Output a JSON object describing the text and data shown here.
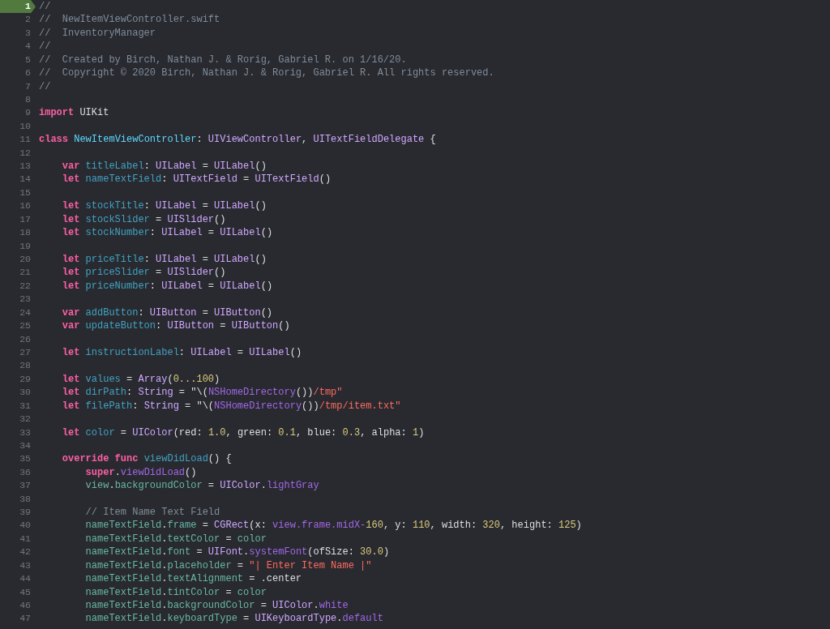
{
  "editor": {
    "lines": [
      {
        "number": "1",
        "selected": true,
        "tokens": [
          {
            "kind": "comment",
            "text": "//"
          }
        ]
      },
      {
        "number": "2",
        "selected": false,
        "tokens": [
          {
            "kind": "comment",
            "text": "//  NewItemViewController.swift"
          }
        ]
      },
      {
        "number": "3",
        "selected": false,
        "tokens": [
          {
            "kind": "comment",
            "text": "//  InventoryManager"
          }
        ]
      },
      {
        "number": "4",
        "selected": false,
        "tokens": [
          {
            "kind": "comment",
            "text": "//"
          }
        ]
      },
      {
        "number": "5",
        "selected": false,
        "tokens": [
          {
            "kind": "comment",
            "text": "//  Created by Birch, Nathan J. & Rorig, Gabriel R. on 1/16/20."
          }
        ]
      },
      {
        "number": "6",
        "selected": false,
        "tokens": [
          {
            "kind": "comment",
            "text": "//  Copyright © 2020 Birch, Nathan J. & Rorig, Gabriel R. All rights reserved."
          }
        ]
      },
      {
        "number": "7",
        "selected": false,
        "tokens": [
          {
            "kind": "comment",
            "text": "//"
          }
        ]
      },
      {
        "number": "8",
        "selected": false
      },
      {
        "number": "9",
        "selected": false,
        "tokens": [
          {
            "kind": "keyword",
            "text": "import"
          },
          {
            "kind": "plain",
            "text": " UIKit"
          }
        ]
      },
      {
        "number": "10",
        "selected": false
      },
      {
        "number": "11",
        "selected": false,
        "tokens": [
          {
            "kind": "keyword",
            "text": "class "
          },
          {
            "kind": "typedecl",
            "text": "NewItemViewController"
          },
          {
            "kind": "plain",
            "text": ": "
          },
          {
            "kind": "type",
            "text": "UIViewController"
          },
          {
            "kind": "plain",
            "text": ", "
          },
          {
            "kind": "type",
            "text": "UITextFieldDelegate"
          },
          {
            "kind": "plain",
            "text": " {"
          }
        ]
      },
      {
        "number": "12",
        "selected": false
      },
      {
        "number": "13",
        "selected": false,
        "tokens": [
          {
            "kind": "keyword",
            "text": "    var "
          },
          {
            "kind": "decl",
            "text": "titleLabel"
          },
          {
            "kind": "plain",
            "text": ": "
          },
          {
            "kind": "type",
            "text": "UILabel"
          },
          {
            "kind": "plain",
            "text": " = "
          },
          {
            "kind": "type",
            "text": "UILabel"
          },
          {
            "kind": "plain",
            "text": "()"
          }
        ]
      },
      {
        "number": "14",
        "selected": false,
        "tokens": [
          {
            "kind": "keyword",
            "text": "    let "
          },
          {
            "kind": "decl",
            "text": "nameTextField"
          },
          {
            "kind": "plain",
            "text": ": "
          },
          {
            "kind": "type",
            "text": "UITextField"
          },
          {
            "kind": "plain",
            "text": " = "
          },
          {
            "kind": "type",
            "text": "UITextField"
          },
          {
            "kind": "plain",
            "text": "()"
          }
        ]
      },
      {
        "number": "15",
        "selected": false
      },
      {
        "number": "16",
        "selected": false,
        "tokens": [
          {
            "kind": "keyword",
            "text": "    let "
          },
          {
            "kind": "decl",
            "text": "stockTitle"
          },
          {
            "kind": "plain",
            "text": ": "
          },
          {
            "kind": "type",
            "text": "UILabel"
          },
          {
            "kind": "plain",
            "text": " = "
          },
          {
            "kind": "type",
            "text": "UILabel"
          },
          {
            "kind": "plain",
            "text": "()"
          }
        ]
      },
      {
        "number": "17",
        "selected": false,
        "tokens": [
          {
            "kind": "keyword",
            "text": "    let "
          },
          {
            "kind": "decl",
            "text": "stockSlider"
          },
          {
            "kind": "plain",
            "text": " = "
          },
          {
            "kind": "type",
            "text": "UISlider"
          },
          {
            "kind": "plain",
            "text": "()"
          }
        ]
      },
      {
        "number": "18",
        "selected": false,
        "tokens": [
          {
            "kind": "keyword",
            "text": "    let "
          },
          {
            "kind": "decl",
            "text": "stockNumber"
          },
          {
            "kind": "plain",
            "text": ": "
          },
          {
            "kind": "type",
            "text": "UILabel"
          },
          {
            "kind": "plain",
            "text": " = "
          },
          {
            "kind": "type",
            "text": "UILabel"
          },
          {
            "kind": "plain",
            "text": "()"
          }
        ]
      },
      {
        "number": "19",
        "selected": false
      },
      {
        "number": "20",
        "selected": false,
        "tokens": [
          {
            "kind": "keyword",
            "text": "    let "
          },
          {
            "kind": "decl",
            "text": "priceTitle"
          },
          {
            "kind": "plain",
            "text": ": "
          },
          {
            "kind": "type",
            "text": "UILabel"
          },
          {
            "kind": "plain",
            "text": " = "
          },
          {
            "kind": "type",
            "text": "UILabel"
          },
          {
            "kind": "plain",
            "text": "()"
          }
        ]
      },
      {
        "number": "21",
        "selected": false,
        "tokens": [
          {
            "kind": "keyword",
            "text": "    let "
          },
          {
            "kind": "decl",
            "text": "priceSlider"
          },
          {
            "kind": "plain",
            "text": " = "
          },
          {
            "kind": "type",
            "text": "UISlider"
          },
          {
            "kind": "plain",
            "text": "()"
          }
        ]
      },
      {
        "number": "22",
        "selected": false,
        "tokens": [
          {
            "kind": "keyword",
            "text": "    let "
          },
          {
            "kind": "decl",
            "text": "priceNumber"
          },
          {
            "kind": "plain",
            "text": ": "
          },
          {
            "kind": "type",
            "text": "UILabel"
          },
          {
            "kind": "plain",
            "text": " = "
          },
          {
            "kind": "type",
            "text": "UILabel"
          },
          {
            "kind": "plain",
            "text": "()"
          }
        ]
      },
      {
        "number": "23",
        "selected": false
      },
      {
        "number": "24",
        "selected": false,
        "tokens": [
          {
            "kind": "keyword",
            "text": "    var "
          },
          {
            "kind": "decl",
            "text": "addButton"
          },
          {
            "kind": "plain",
            "text": ": "
          },
          {
            "kind": "type",
            "text": "UIButton"
          },
          {
            "kind": "plain",
            "text": " = "
          },
          {
            "kind": "type",
            "text": "UIButton"
          },
          {
            "kind": "plain",
            "text": "()"
          }
        ]
      },
      {
        "number": "25",
        "selected": false,
        "tokens": [
          {
            "kind": "keyword",
            "text": "    var "
          },
          {
            "kind": "decl",
            "text": "updateButton"
          },
          {
            "kind": "plain",
            "text": ": "
          },
          {
            "kind": "type",
            "text": "UIButton"
          },
          {
            "kind": "plain",
            "text": " = "
          },
          {
            "kind": "type",
            "text": "UIButton"
          },
          {
            "kind": "plain",
            "text": "()"
          }
        ]
      },
      {
        "number": "26",
        "selected": false
      },
      {
        "number": "27",
        "selected": false,
        "tokens": [
          {
            "kind": "keyword",
            "text": "    let "
          },
          {
            "kind": "decl",
            "text": "instructionLabel"
          },
          {
            "kind": "plain",
            "text": ": "
          },
          {
            "kind": "type",
            "text": "UILabel"
          },
          {
            "kind": "plain",
            "text": " = "
          },
          {
            "kind": "type",
            "text": "UILabel"
          },
          {
            "kind": "plain",
            "text": "()"
          }
        ]
      },
      {
        "number": "28",
        "selected": false
      },
      {
        "number": "29",
        "selected": false,
        "tokens": [
          {
            "kind": "keyword",
            "text": "    let "
          },
          {
            "kind": "decl",
            "text": "values"
          },
          {
            "kind": "plain",
            "text": " = "
          },
          {
            "kind": "type",
            "text": "Array"
          },
          {
            "kind": "plain",
            "text": "("
          },
          {
            "kind": "number",
            "text": "0...100"
          },
          {
            "kind": "plain",
            "text": ")"
          }
        ]
      },
      {
        "number": "30",
        "selected": false,
        "tokens": [
          {
            "kind": "keyword",
            "text": "    let "
          },
          {
            "kind": "decl",
            "text": "dirPath"
          },
          {
            "kind": "plain",
            "text": ": "
          },
          {
            "kind": "type",
            "text": "String"
          },
          {
            "kind": "plain",
            "text": " = \"\\("
          },
          {
            "kind": "member",
            "text": "NSHomeDirectory"
          },
          {
            "kind": "plain",
            "text": "())"
          },
          {
            "kind": "string",
            "text": "/tmp\""
          }
        ]
      },
      {
        "number": "31",
        "selected": false,
        "tokens": [
          {
            "kind": "keyword",
            "text": "    let "
          },
          {
            "kind": "decl",
            "text": "filePath"
          },
          {
            "kind": "plain",
            "text": ": "
          },
          {
            "kind": "type",
            "text": "String"
          },
          {
            "kind": "plain",
            "text": " = \"\\("
          },
          {
            "kind": "member",
            "text": "NSHomeDirectory"
          },
          {
            "kind": "plain",
            "text": "())"
          },
          {
            "kind": "string",
            "text": "/tmp/item.txt\""
          }
        ]
      },
      {
        "number": "32",
        "selected": false
      },
      {
        "number": "33",
        "selected": false,
        "tokens": [
          {
            "kind": "keyword",
            "text": "    let "
          },
          {
            "kind": "decl",
            "text": "color"
          },
          {
            "kind": "plain",
            "text": " = "
          },
          {
            "kind": "type",
            "text": "UIColor"
          },
          {
            "kind": "plain",
            "text": "(red: "
          },
          {
            "kind": "number",
            "text": "1.0"
          },
          {
            "kind": "plain",
            "text": ", green: "
          },
          {
            "kind": "number",
            "text": "0.1"
          },
          {
            "kind": "plain",
            "text": ", blue: "
          },
          {
            "kind": "number",
            "text": "0.3"
          },
          {
            "kind": "plain",
            "text": ", alpha: "
          },
          {
            "kind": "number",
            "text": "1"
          },
          {
            "kind": "plain",
            "text": ")"
          }
        ]
      },
      {
        "number": "34",
        "selected": false
      },
      {
        "number": "35",
        "selected": false,
        "tokens": [
          {
            "kind": "keyword",
            "text": "    override func "
          },
          {
            "kind": "decl",
            "text": "viewDidLoad"
          },
          {
            "kind": "plain",
            "text": "() {"
          }
        ]
      },
      {
        "number": "36",
        "selected": false,
        "tokens": [
          {
            "kind": "keyword",
            "text": "        super"
          },
          {
            "kind": "plain",
            "text": "."
          },
          {
            "kind": "member",
            "text": "viewDidLoad"
          },
          {
            "kind": "plain",
            "text": "()"
          }
        ]
      },
      {
        "number": "37",
        "selected": false,
        "tokens": [
          {
            "kind": "project",
            "text": "        view"
          },
          {
            "kind": "plain",
            "text": "."
          },
          {
            "kind": "project",
            "text": "backgroundColor"
          },
          {
            "kind": "plain",
            "text": " = "
          },
          {
            "kind": "type",
            "text": "UIColor"
          },
          {
            "kind": "plain",
            "text": "."
          },
          {
            "kind": "member",
            "text": "lightGray"
          }
        ]
      },
      {
        "number": "38",
        "selected": false
      },
      {
        "number": "39",
        "selected": false,
        "tokens": [
          {
            "kind": "comment",
            "text": "        // Item Name Text Field"
          }
        ]
      },
      {
        "number": "40",
        "selected": false,
        "tokens": [
          {
            "kind": "project",
            "text": "        nameTextField"
          },
          {
            "kind": "plain",
            "text": "."
          },
          {
            "kind": "project",
            "text": "frame"
          },
          {
            "kind": "plain",
            "text": " = "
          },
          {
            "kind": "type",
            "text": "CGRect"
          },
          {
            "kind": "plain",
            "text": "(x: "
          },
          {
            "kind": "member",
            "text": "view.frame.midX-"
          },
          {
            "kind": "number",
            "text": "160"
          },
          {
            "kind": "plain",
            "text": ", y: "
          },
          {
            "kind": "number",
            "text": "110"
          },
          {
            "kind": "plain",
            "text": ", width: "
          },
          {
            "kind": "number",
            "text": "320"
          },
          {
            "kind": "plain",
            "text": ", height: "
          },
          {
            "kind": "number",
            "text": "125"
          },
          {
            "kind": "plain",
            "text": ")"
          }
        ]
      },
      {
        "number": "41",
        "selected": false,
        "tokens": [
          {
            "kind": "project",
            "text": "        nameTextField"
          },
          {
            "kind": "plain",
            "text": "."
          },
          {
            "kind": "project",
            "text": "textColor"
          },
          {
            "kind": "plain",
            "text": " = "
          },
          {
            "kind": "project",
            "text": "color"
          }
        ]
      },
      {
        "number": "42",
        "selected": false,
        "tokens": [
          {
            "kind": "project",
            "text": "        nameTextField"
          },
          {
            "kind": "plain",
            "text": "."
          },
          {
            "kind": "project",
            "text": "font"
          },
          {
            "kind": "plain",
            "text": " = "
          },
          {
            "kind": "type",
            "text": "UIFont"
          },
          {
            "kind": "plain",
            "text": "."
          },
          {
            "kind": "member",
            "text": "systemFont"
          },
          {
            "kind": "plain",
            "text": "(ofSize: "
          },
          {
            "kind": "number",
            "text": "30.0"
          },
          {
            "kind": "plain",
            "text": ")"
          }
        ]
      },
      {
        "number": "43",
        "selected": false,
        "tokens": [
          {
            "kind": "project",
            "text": "        nameTextField"
          },
          {
            "kind": "plain",
            "text": "."
          },
          {
            "kind": "project",
            "text": "placeholder"
          },
          {
            "kind": "plain",
            "text": " = "
          },
          {
            "kind": "string",
            "text": "\"| Enter Item Name |\""
          }
        ]
      },
      {
        "number": "44",
        "selected": false,
        "tokens": [
          {
            "kind": "project",
            "text": "        nameTextField"
          },
          {
            "kind": "plain",
            "text": "."
          },
          {
            "kind": "project",
            "text": "textAlignment"
          },
          {
            "kind": "plain",
            "text": " = .center"
          }
        ]
      },
      {
        "number": "45",
        "selected": false,
        "tokens": [
          {
            "kind": "project",
            "text": "        nameTextField"
          },
          {
            "kind": "plain",
            "text": "."
          },
          {
            "kind": "project",
            "text": "tintColor"
          },
          {
            "kind": "plain",
            "text": " = "
          },
          {
            "kind": "project",
            "text": "color"
          }
        ]
      },
      {
        "number": "46",
        "selected": false,
        "tokens": [
          {
            "kind": "project",
            "text": "        nameTextField"
          },
          {
            "kind": "plain",
            "text": "."
          },
          {
            "kind": "project",
            "text": "backgroundColor"
          },
          {
            "kind": "plain",
            "text": " = "
          },
          {
            "kind": "type",
            "text": "UIColor"
          },
          {
            "kind": "plain",
            "text": "."
          },
          {
            "kind": "member",
            "text": "white"
          }
        ]
      },
      {
        "number": "47",
        "selected": false,
        "tokens": [
          {
            "kind": "project",
            "text": "        nameTextField"
          },
          {
            "kind": "plain",
            "text": "."
          },
          {
            "kind": "project",
            "text": "keyboardType"
          },
          {
            "kind": "plain",
            "text": " = "
          },
          {
            "kind": "type",
            "text": "UIKeyboardType"
          },
          {
            "kind": "plain",
            "text": "."
          },
          {
            "kind": "member",
            "text": "default"
          }
        ]
      }
    ]
  }
}
